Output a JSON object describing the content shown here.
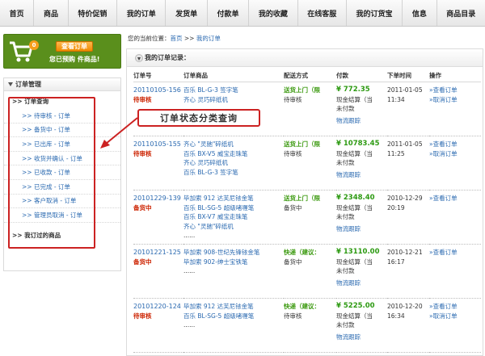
{
  "nav": [
    "首页",
    "商品",
    "特价促销",
    "我的订单",
    "发货单",
    "付款单",
    "我的收藏",
    "在线客服",
    "我的订货宝",
    "信息",
    "商品目录"
  ],
  "cart": {
    "count": "0",
    "button": "查看订单",
    "note": "您已预购 件商品!"
  },
  "sidebar": {
    "title": "订单管理",
    "group": ">> 订单查询",
    "items": [
      ">> 待审核 - 订单",
      ">> 备货中 - 订单",
      ">> 已出库 - 订单",
      ">> 收货并确认 - 订单",
      ">> 已收款 - 订单",
      ">> 已完成 - 订单",
      ">> 客户取消 - 订单",
      ">> 管理员取消 - 订单"
    ],
    "bottom": ">> 我订过的商品"
  },
  "breadcrumb": {
    "label": "您的当前位置：",
    "home": "首页",
    "sep1": " >> ",
    "current": "我的订单"
  },
  "main": {
    "title": "我的订单记录："
  },
  "callout": "订单状态分类查询",
  "table": {
    "headers": [
      "订单号",
      "订单商品",
      "配送方式",
      "付款",
      "下单时间",
      "操作"
    ],
    "rows": [
      {
        "id": "20110105-156",
        "status": "待审核",
        "products": [
          "百乐 BL-G-3 签字笔",
          "齐心 灵巧碎纸机"
        ],
        "more": "",
        "ship": "送货上门（限",
        "ship_status": "待审核",
        "price": "¥ 772.35",
        "pay1": "现金结算（当",
        "pay2": "未付款",
        "track": "物流跟踪",
        "date": "2011-01-05",
        "time": "11:34",
        "op1": "»查看订单",
        "op2": "»取消订单"
      },
      {
        "id": "20110105-155",
        "status": "待审核",
        "products": [
          "齐心 \"灵驰\"碎纸机",
          "百乐 BX-V5 威宝走珠笔",
          "齐心 灵巧碎纸机",
          "百乐 BL-G-3 签字笔"
        ],
        "more": "",
        "ship": "送货上门（限",
        "ship_status": "待审核",
        "price": "¥ 10783.45",
        "pay1": "现金结算（当",
        "pay2": "未付款",
        "track": "物流跟踪",
        "date": "2011-01-05",
        "time": "11:25",
        "op1": "»查看订单",
        "op2": "»取消订单"
      },
      {
        "id": "20101229-139",
        "status": "备货中",
        "products": [
          "毕加索 912 达芙尼铱金笔",
          "百乐 BL-SG-5 超级啫喱笔",
          "百乐 BX-V7 威宝走珠笔",
          "齐心 \"灵驰\"碎纸机"
        ],
        "more": "......",
        "ship": "送货上门（限",
        "ship_status": "备货中",
        "price": "¥ 2348.40",
        "pay1": "现金结算（当",
        "pay2": "未付款",
        "track": "物流跟踪",
        "date": "2010-12-29",
        "time": "20:19",
        "op1": "»查看订单",
        "op2": ""
      },
      {
        "id": "20101221-125",
        "status": "备货中",
        "products": [
          "毕加索 908-世纪先锋铱金笔",
          "毕加索 902-绅士宝铁笔"
        ],
        "more": "......",
        "ship": "快递（建议：",
        "ship_status": "备货中",
        "price": "¥ 13110.00",
        "pay1": "现金结算（当",
        "pay2": "未付款",
        "track": "物流跟踪",
        "date": "2010-12-21",
        "time": "16:17",
        "op1": "»查看订单",
        "op2": ""
      },
      {
        "id": "20101220-124",
        "status": "待审核",
        "products": [
          "毕加索 912 达芙尼铱金笔",
          "百乐 BL-SG-5 超级啫喱笔"
        ],
        "more": "......",
        "ship": "快递（建议：",
        "ship_status": "待审核",
        "price": "¥ 5225.00",
        "pay1": "现金结算（当",
        "pay2": "未付款",
        "track": "物流跟踪",
        "date": "2010-12-20",
        "time": "16:34",
        "op1": "»查看订单",
        "op2": "»取消订单"
      }
    ]
  },
  "colors": {
    "accent_green": "#5a8f1c",
    "link": "#2a69b0",
    "status_red": "#cc2200",
    "price_green": "#2d9a12",
    "annotation_red": "#cc2222"
  }
}
